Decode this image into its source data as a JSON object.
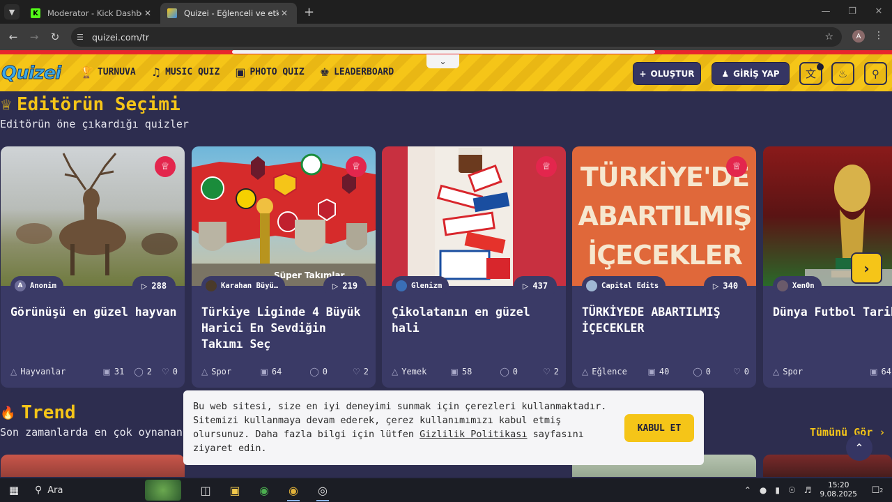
{
  "browser": {
    "tabs": [
      {
        "title": "Moderator - Kick Dashboard",
        "favicon": "kick-logo"
      },
      {
        "title": "Quizei - Eğlenceli ve etkileşimli",
        "favicon": "quizei-logo"
      }
    ],
    "url": "quizei.com/tr",
    "profile_initial": "A"
  },
  "header": {
    "logo": "Quizei",
    "nav": [
      {
        "label": "TURNUVA",
        "icon": "trophy-icon"
      },
      {
        "label": "MUSIC QUIZ",
        "icon": "music-icon"
      },
      {
        "label": "PHOTO QUIZ",
        "icon": "camera-icon"
      },
      {
        "label": "LEADERBOARD",
        "icon": "award-icon"
      }
    ],
    "create_label": "OLUŞTUR",
    "login_label": "GİRİŞ YAP",
    "accent": "#f5c518"
  },
  "editors": {
    "title": "Editörün Seçimi",
    "subtitle": "Editörün öne çıkardığı quizler",
    "cards": [
      {
        "author": "Anonim",
        "author_initial": "A",
        "plays": "288",
        "title": "Görünüşü en güzel hayvan",
        "category": "Hayvanlar",
        "questions": "31",
        "comments": "2",
        "likes": "0"
      },
      {
        "author": "Karahan Büyü…",
        "author_initial": "",
        "plays": "219",
        "title": "Türkiye Liginde 4 Büyük Harici En Sevdiğin Takımı Seç",
        "category": "Spor",
        "questions": "64",
        "comments": "0",
        "likes": "2"
      },
      {
        "author": "Glenizm",
        "author_initial": "",
        "plays": "437",
        "title": "Çikolatanın en güzel hali",
        "category": "Yemek",
        "questions": "58",
        "comments": "0",
        "likes": "2"
      },
      {
        "author": "Capital Edits",
        "author_initial": "",
        "plays": "340",
        "title": "TÜRKİYEDE ABARTILMIŞ İÇECEKLER",
        "category": "Eğlence",
        "questions": "40",
        "comments": "0",
        "likes": "0"
      },
      {
        "author": "Xen0n",
        "author_initial": "",
        "plays": "",
        "title": "Dünya Futbol Tarihi En İyi Maçı",
        "category": "Spor",
        "questions": "64",
        "comments": "",
        "likes": ""
      }
    ],
    "card4_image_text": "TÜRKİYE'DE ABARTILMIŞ İÇECEKLER",
    "card2_image_text": "Süper Takımlar"
  },
  "trend": {
    "title": "Trend",
    "subtitle": "Son zamanlarda en çok oynanan",
    "see_all": "Tümünü Gör"
  },
  "cookie": {
    "text_before": "Bu web sitesi, size en iyi deneyimi sunmak için çerezleri kullanmaktadır. Sitemizi kullanmaya devam ederek, çerez kullanımımızı kabul etmiş olursunuz. Daha fazla bilgi için lütfen ",
    "link": "Gizlilik Politikası",
    "text_after": " sayfasını ziyaret edin.",
    "accept": "KABUL ET"
  },
  "taskbar": {
    "search": "Ara",
    "time": "15:20",
    "date": "9.08.2025",
    "notifications": "2"
  }
}
